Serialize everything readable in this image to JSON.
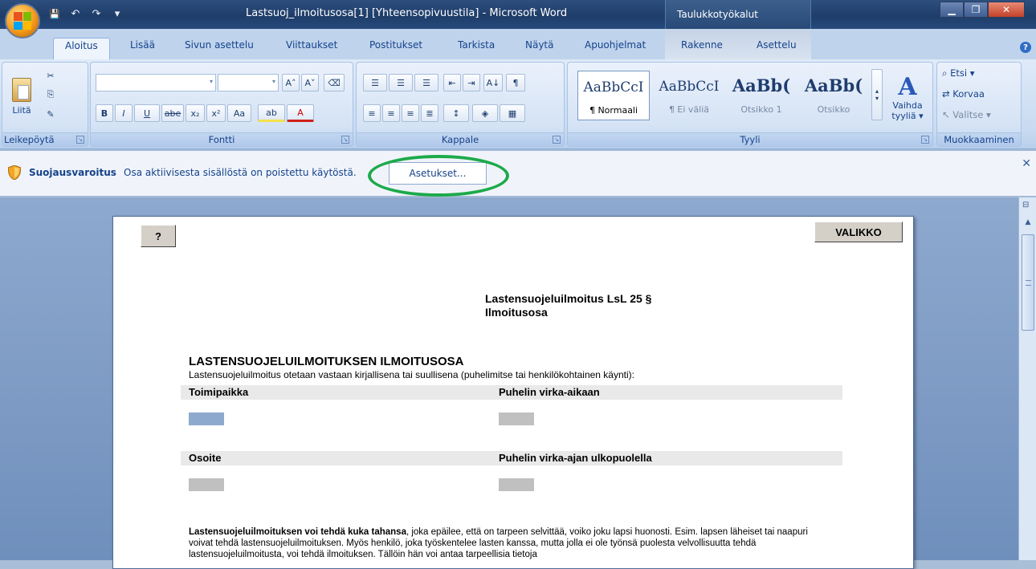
{
  "window": {
    "title": "Lastsuoj_ilmoitusosa[1] [Yhteensopivuustila] - Microsoft Word",
    "context_group": "Taulukkotyökalut",
    "controls": {
      "minimize": "▁",
      "maximize": "❐",
      "close": "✕"
    }
  },
  "qat": {
    "save": "💾",
    "undo": "↶",
    "redo": "↷",
    "customize": "▾"
  },
  "tabs": [
    "Aloitus",
    "Lisää",
    "Sivun asettelu",
    "Viittaukset",
    "Postitukset",
    "Tarkista",
    "Näytä",
    "Apuohjelmat",
    "Rakenne",
    "Asettelu"
  ],
  "ribbon": {
    "clipboard": {
      "label": "Leikepöytä",
      "paste": "Liitä",
      "cut": "✂",
      "copy": "⎘",
      "painter": "✎"
    },
    "font": {
      "label": "Fontti",
      "bold": "B",
      "italic": "I",
      "underline": "U",
      "strike": "abe",
      "sub": "x₂",
      "sup": "x²",
      "case": "Aa",
      "grow": "A˄",
      "shrink": "A˅",
      "clear": "⌫",
      "highlight": "ab",
      "color": "A"
    },
    "paragraph": {
      "label": "Kappale",
      "pilcrow": "¶",
      "sort": "A↓"
    },
    "styles": {
      "label": "Tyyli",
      "items": [
        {
          "sample": "AaBbCcI",
          "name": "¶ Normaali"
        },
        {
          "sample": "AaBbCcI",
          "name": "¶ Ei väliä"
        },
        {
          "sample": "AaBb(",
          "name": "Otsikko 1"
        },
        {
          "sample": "AaBb(",
          "name": "Otsikko"
        }
      ],
      "change": "Vaihda tyyliä ▾"
    },
    "editing": {
      "label": "Muokkaaminen",
      "find": "Etsi ▾",
      "replace": "Korvaa",
      "select": "Valitse ▾"
    }
  },
  "security": {
    "title": "Suojausvaroitus",
    "text": "Osa aktiivisesta sisällöstä on poistettu käytöstä.",
    "button": "Asetukset..."
  },
  "doc": {
    "help_button": "?",
    "menu_button": "VALIKKO",
    "title_line1": "Lastensuojeluilmoitus  LsL 25 §",
    "title_line2": "Ilmoitusosa",
    "section_head": "LASTENSUOJELUILMOITUKSEN  ILMOITUSOSA",
    "section_sub": "Lastensuojeluilmoitus otetaan vastaan kirjallisena tai suullisena (puhelimitse tai henkilökohtainen käynti):",
    "row1_left": "Toimipaikka",
    "row1_right": "Puhelin virka-aikaan",
    "row2_left": "Osoite",
    "row2_right": "Puhelin virka-ajan ulkopuolella",
    "para_bold": "Lastensuojeluilmoituksen voi tehdä kuka tahansa",
    "para_rest": ", joka epäilee, että on tarpeen selvittää, voiko joku lapsi huonosti. Esim. lapsen läheiset tai naapuri voivat tehdä lastensuojeluilmoituksen. Myös henkilö, joka työskentelee lasten kanssa, mutta jolla ei ole työnsä puolesta velvollisuutta tehdä lastensuojeluilmoitusta, voi tehdä ilmoituksen. Tällöin hän voi antaa tarpeellisia tietoja"
  }
}
